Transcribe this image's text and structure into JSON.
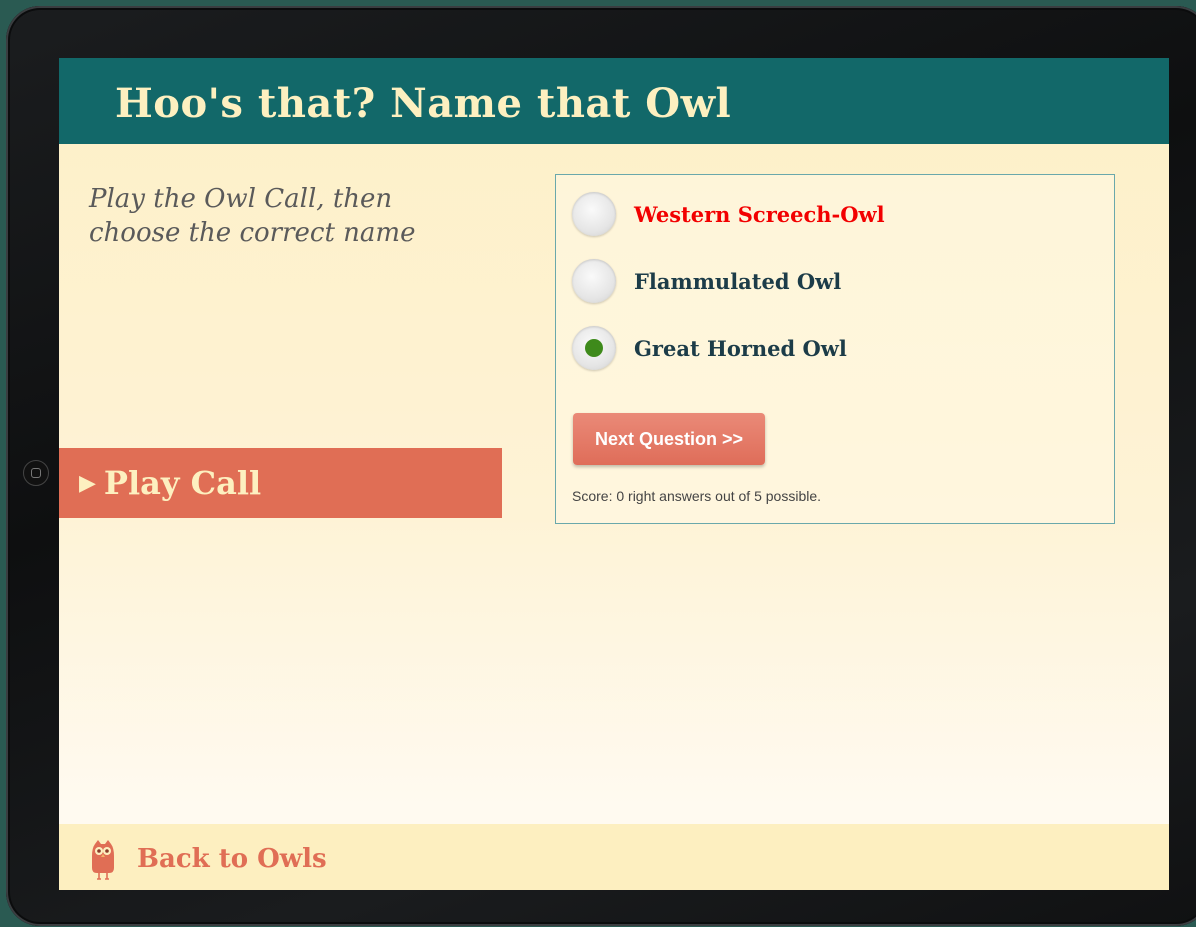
{
  "header": {
    "title": "Hoo's that? Name that Owl"
  },
  "instructions": {
    "text": "Play the Owl Call, then choose the correct name"
  },
  "play_call": {
    "label": "Play Call",
    "icon": "play-triangle-icon"
  },
  "quiz": {
    "options": [
      {
        "label": "Western Screech-Owl",
        "state": "wrong",
        "selected": false
      },
      {
        "label": "Flammulated Owl",
        "state": "neutral",
        "selected": false
      },
      {
        "label": "Great Horned Owl",
        "state": "correct",
        "selected": true
      }
    ],
    "next_button": {
      "label": "Next Question >>"
    },
    "score_text": "Score: 0 right answers out of 5 possible."
  },
  "footer": {
    "back_label": "Back to Owls",
    "icon": "owl-icon"
  },
  "colors": {
    "header_bg": "#126869",
    "accent": "#e06e55",
    "wrong_text": "#f20000",
    "selected_dot": "#3e8a1b"
  }
}
